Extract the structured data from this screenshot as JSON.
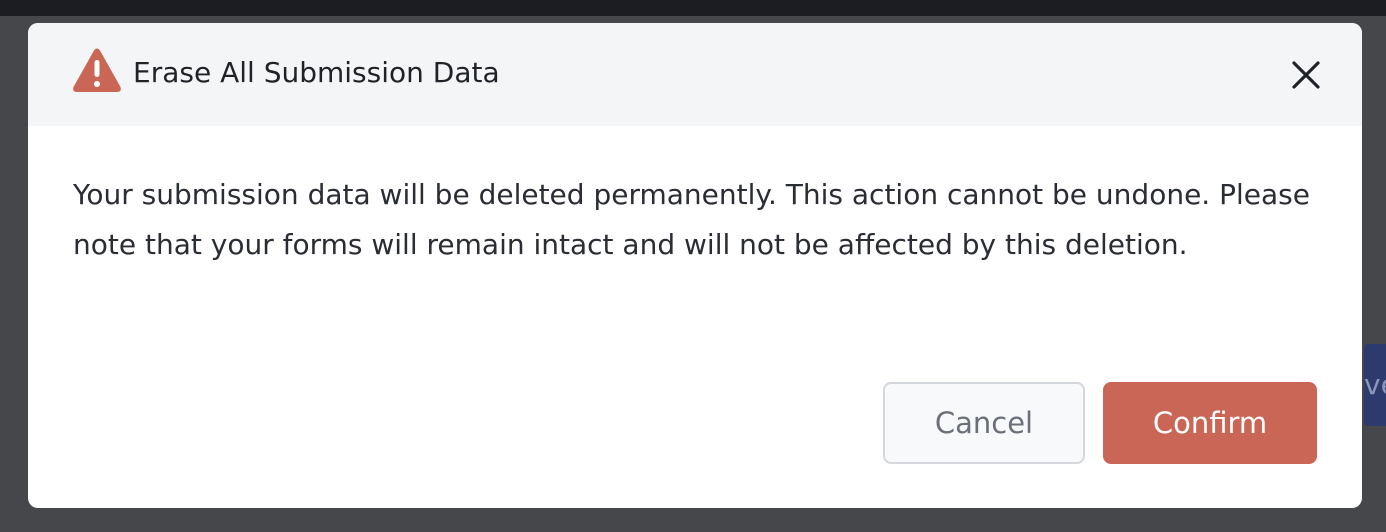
{
  "dialog": {
    "title": "Erase All Submission Data",
    "message": "Your submission data will be deleted permanently. This action cannot be undone. Please note that your forms will remain intact and will not be affected by this deletion.",
    "icon": "warning-triangle-icon",
    "close_icon": "close-icon",
    "accent_color": "#c96656"
  },
  "buttons": {
    "cancel_label": "Cancel",
    "confirm_label": "Confirm"
  },
  "background": {
    "partial_button_text": "ve"
  }
}
